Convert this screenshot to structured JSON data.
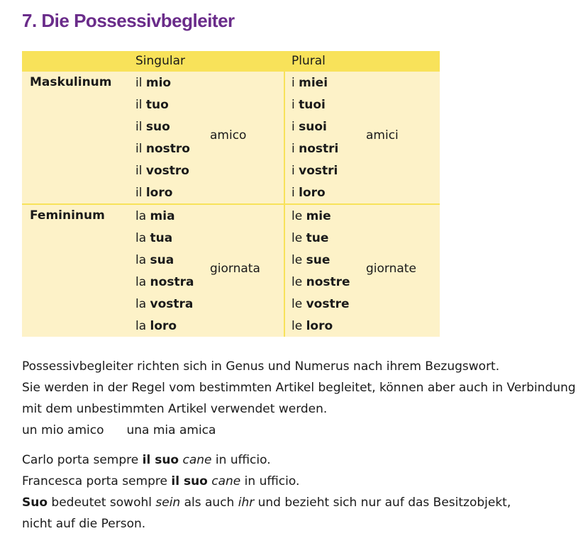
{
  "title": "7. Die Possessivbegleiter",
  "table": {
    "headers": {
      "singular": "Singular",
      "plural": "Plural"
    },
    "groups": [
      {
        "label": "Maskulinum",
        "singular": [
          {
            "art": "il",
            "poss": "mio"
          },
          {
            "art": "il",
            "poss": "tuo"
          },
          {
            "art": "il",
            "poss": "suo"
          },
          {
            "art": "il",
            "poss": "nostro"
          },
          {
            "art": "il",
            "poss": "vostro"
          },
          {
            "art": "il",
            "poss": "loro"
          }
        ],
        "singular_noun": "amico",
        "plural": [
          {
            "art": "i",
            "poss": "miei"
          },
          {
            "art": "i",
            "poss": "tuoi"
          },
          {
            "art": "i",
            "poss": "suoi"
          },
          {
            "art": "i",
            "poss": "nostri"
          },
          {
            "art": "i",
            "poss": "vostri"
          },
          {
            "art": "i",
            "poss": "loro"
          }
        ],
        "plural_noun": "amici"
      },
      {
        "label": "Femininum",
        "singular": [
          {
            "art": "la",
            "poss": "mia"
          },
          {
            "art": "la",
            "poss": "tua"
          },
          {
            "art": "la",
            "poss": "sua"
          },
          {
            "art": "la",
            "poss": "nostra"
          },
          {
            "art": "la",
            "poss": "vostra"
          },
          {
            "art": "la",
            "poss": "loro"
          }
        ],
        "singular_noun": "giornata",
        "plural": [
          {
            "art": "le",
            "poss": "mie"
          },
          {
            "art": "le",
            "poss": "tue"
          },
          {
            "art": "le",
            "poss": "sue"
          },
          {
            "art": "le",
            "poss": "nostre"
          },
          {
            "art": "le",
            "poss": "vostre"
          },
          {
            "art": "le",
            "poss": "loro"
          }
        ],
        "plural_noun": "giornate"
      }
    ]
  },
  "explanation": {
    "line1": "Possessivbegleiter richten sich in Genus und Numerus nach ihrem Bezugswort.",
    "line2": "Sie werden in der Regel vom bestimmten Artikel begleitet, können aber auch in Verbindung",
    "line3": "mit dem unbestimmten Artikel verwendet werden.",
    "example1": "un mio amico",
    "example2": "una mia amica"
  },
  "examples": {
    "carlo": {
      "pre": "Carlo porta sempre ",
      "poss": "il suo",
      "noun": "cane",
      "post": " in ufficio."
    },
    "francesca": {
      "pre": "Francesca porta sempre ",
      "poss": "il suo",
      "noun": "cane",
      "post": " in ufficio."
    },
    "note": {
      "word": "Suo",
      "t1": " bedeutet sowohl ",
      "sein": "sein",
      "t2": " als auch ",
      "ihr": "ihr",
      "t3": " und bezieht sich nur auf das Besitzobjekt,",
      "line2": "nicht auf die Person."
    }
  },
  "colors": {
    "title": "#6a2c8a",
    "header": "#f8e25a",
    "table_bg": "#fdf2c8"
  }
}
